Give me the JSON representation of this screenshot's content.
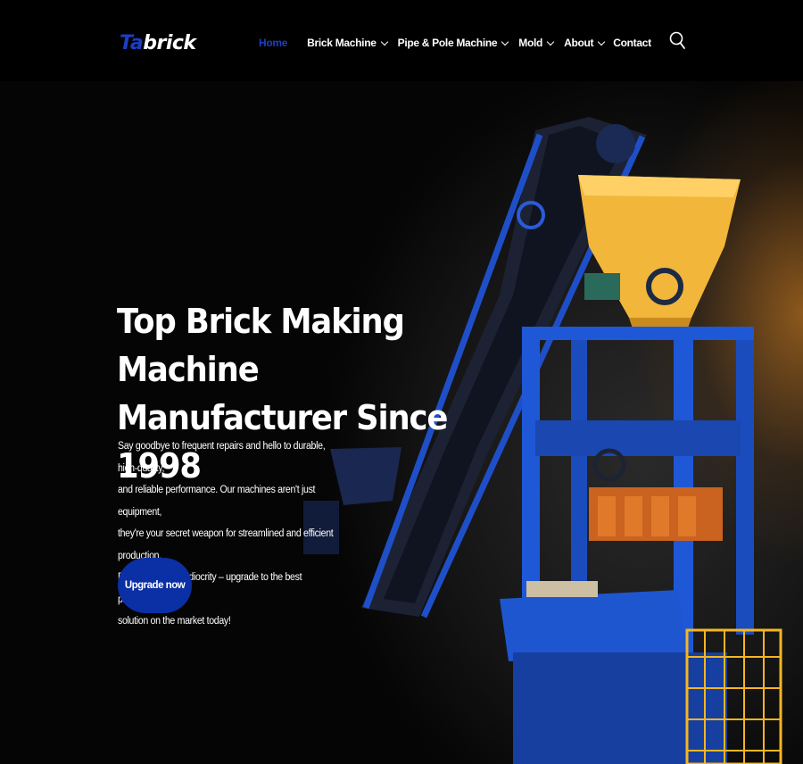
{
  "brand": {
    "logo_part1": "Ta",
    "logo_part2": "brick",
    "accent_color": "#1e3fc0"
  },
  "nav": {
    "items": [
      {
        "label": "Home",
        "active": true,
        "dropdown": false
      },
      {
        "label": "Brick Machine",
        "active": false,
        "dropdown": true
      },
      {
        "label": "Pipe & Pole Machine",
        "active": false,
        "dropdown": true
      },
      {
        "label": "Mold",
        "active": false,
        "dropdown": true
      },
      {
        "label": "About",
        "active": false,
        "dropdown": true
      },
      {
        "label": "Contact",
        "active": false,
        "dropdown": false
      }
    ],
    "search_icon": "search-icon"
  },
  "hero": {
    "title_line1": "Top Brick Making Machine",
    "title_line2": "Manufacturer Since 1998",
    "desc_lines": [
      "Say goodbye to frequent repairs and hello to durable, high-quality,",
      "and reliable performance. Our machines aren't just equipment,",
      "they're your secret weapon for streamlined and efficient production.",
      "Don't settle for mediocrity – upgrade to the best production",
      "solution on the market today!"
    ],
    "cta_label": "Upgrade now",
    "cta_color": "#0b2fa4"
  }
}
